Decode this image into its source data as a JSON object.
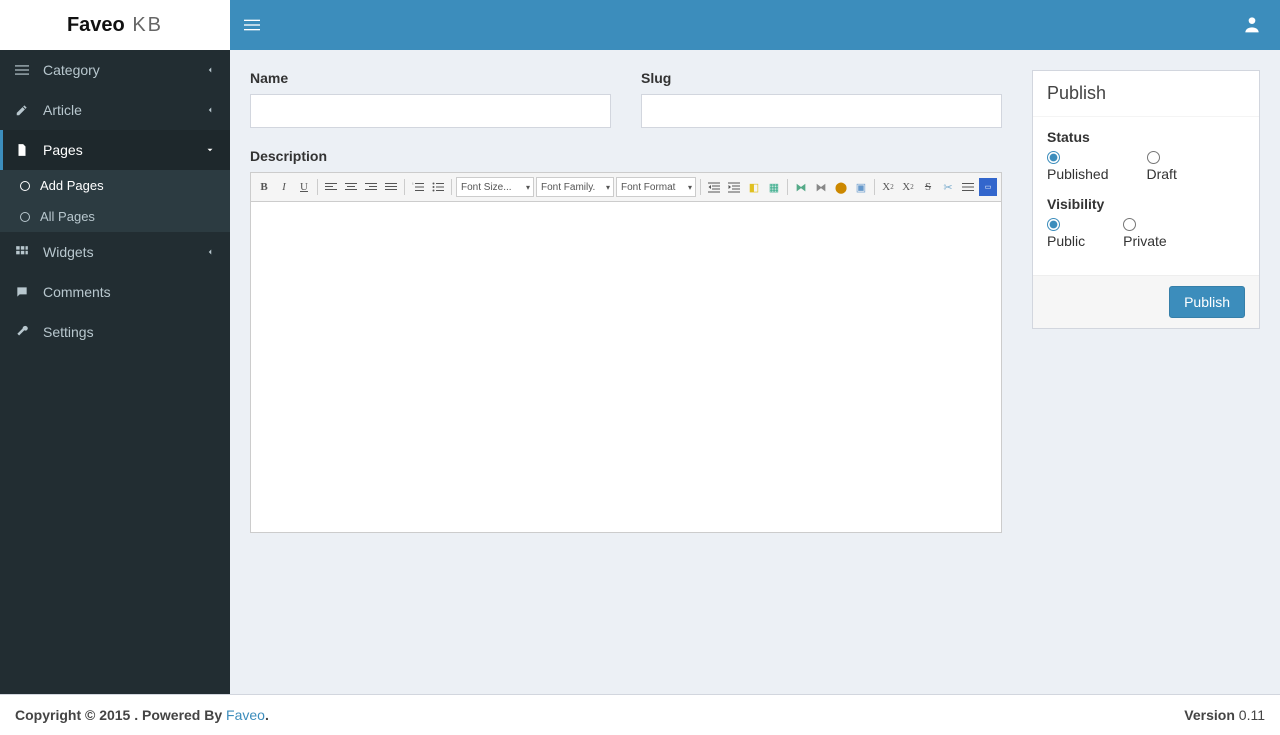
{
  "logo": {
    "brand": "Faveo",
    "suffix": " KB"
  },
  "sidebar": {
    "items": [
      {
        "label": "Category"
      },
      {
        "label": "Article"
      },
      {
        "label": "Pages"
      },
      {
        "label": "Widgets"
      },
      {
        "label": "Comments"
      },
      {
        "label": "Settings"
      }
    ],
    "pages_submenu": [
      {
        "label": "Add Pages"
      },
      {
        "label": "All Pages"
      }
    ]
  },
  "form": {
    "name_label": "Name",
    "name_value": "",
    "slug_label": "Slug",
    "slug_value": "",
    "description_label": "Description"
  },
  "editor_toolbar": {
    "font_size": "Font Size...",
    "font_family": "Font Family.",
    "font_format": "Font Format"
  },
  "publish_box": {
    "title": "Publish",
    "status_label": "Status",
    "status_options": {
      "published": "Published",
      "draft": "Draft"
    },
    "visibility_label": "Visibility",
    "visibility_options": {
      "public": "Public",
      "private": "Private"
    },
    "button": "Publish"
  },
  "footer": {
    "copyright_prefix": "Copyright © 2015 . Powered By ",
    "brand": "Faveo",
    "suffix": ".",
    "version_label": "Version",
    "version_value": " 0.11"
  }
}
